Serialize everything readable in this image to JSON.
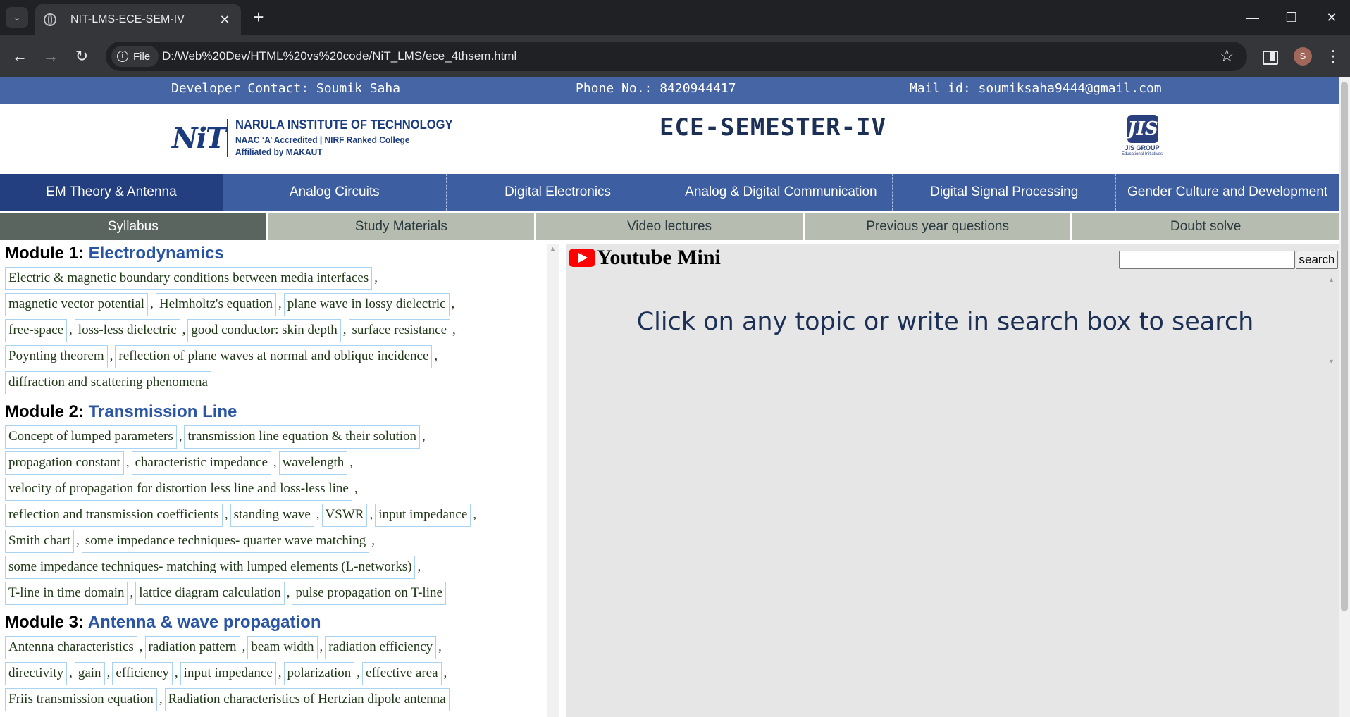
{
  "browser": {
    "tab_title": "NIT-LMS-ECE-SEM-IV",
    "file_chip": "File",
    "url": "D:/Web%20Dev/HTML%20vs%20code/NiT_LMS/ece_4thsem.html",
    "avatar_letter": "S",
    "icons": [
      "tab-list-icon",
      "globe-icon",
      "close-icon",
      "plus-icon",
      "minimize-icon",
      "restore-icon",
      "close-window-icon",
      "back-icon",
      "forward-icon",
      "reload-icon",
      "info-icon",
      "star-icon",
      "side-panel-icon",
      "menu-icon"
    ]
  },
  "contact": {
    "developer": "Developer Contact: Soumik Saha",
    "phone": "Phone No.: 8420944417",
    "mail": "Mail id: soumiksaha9444@gmail.com"
  },
  "header": {
    "nit_mark": "NiT",
    "nit_name": "NARULA INSTITUTE OF TECHNOLOGY",
    "nit_line1": "NAAC ‘A’ Accredited | NIRF Ranked College",
    "nit_line2": "Affiliated by MAKAUT",
    "title": "ECE-SEMESTER-IV",
    "jis_mark": "JIS",
    "jis_text": "JIS GROUP",
    "jis_sub": "Educational Initiatives"
  },
  "subjects": [
    "EM Theory & Antenna",
    "Analog Circuits",
    "Digital Electronics",
    "Analog & Digital Communication",
    "Digital Signal Processing",
    "Gender Culture and Development"
  ],
  "sections": [
    "Syllabus",
    "Study Materials",
    "Video lectures",
    "Previous year questions",
    "Doubt solve"
  ],
  "modules": [
    {
      "label": "Module 1:",
      "name": "Electrodynamics",
      "lines": [
        [
          "Electric & magnetic boundary conditions between media interfaces"
        ],
        [
          "magnetic vector potential",
          "Helmholtz's equation",
          "plane wave in lossy dielectric"
        ],
        [
          "free-space",
          "loss-less dielectric",
          "good conductor: skin depth",
          "surface resistance"
        ],
        [
          "Poynting theorem",
          "reflection of plane waves at normal and oblique incidence"
        ],
        [
          "diffraction and scattering phenomena"
        ]
      ]
    },
    {
      "label": "Module 2:",
      "name": "Transmission Line",
      "lines": [
        [
          "Concept of lumped parameters",
          "transmission line equation & their solution"
        ],
        [
          "propagation constant",
          "characteristic impedance",
          "wavelength"
        ],
        [
          "velocity of propagation for distortion less line and loss-less line"
        ],
        [
          "reflection and transmission coefficients",
          "standing wave",
          "VSWR",
          "input impedance"
        ],
        [
          "Smith chart",
          "some impedance techniques- quarter wave matching"
        ],
        [
          "some impedance techniques- matching with lumped elements (L-networks)"
        ],
        [
          "T-line in time domain",
          "lattice diagram calculation",
          "pulse propagation on T-line"
        ]
      ]
    },
    {
      "label": "Module 3:",
      "name": "Antenna & wave propagation",
      "lines": [
        [
          "Antenna characteristics",
          "radiation pattern",
          "beam width",
          "radiation efficiency"
        ],
        [
          "directivity",
          "gain",
          "efficiency",
          "input impedance",
          "polarization",
          "effective area"
        ],
        [
          "Friis transmission equation",
          "Radiation characteristics of Hertzian dipole antenna"
        ]
      ]
    }
  ],
  "youtube": {
    "title": "Youtube Mini",
    "search_value": "",
    "search_button": "search",
    "message": "Click on any topic or write in search box to search"
  }
}
